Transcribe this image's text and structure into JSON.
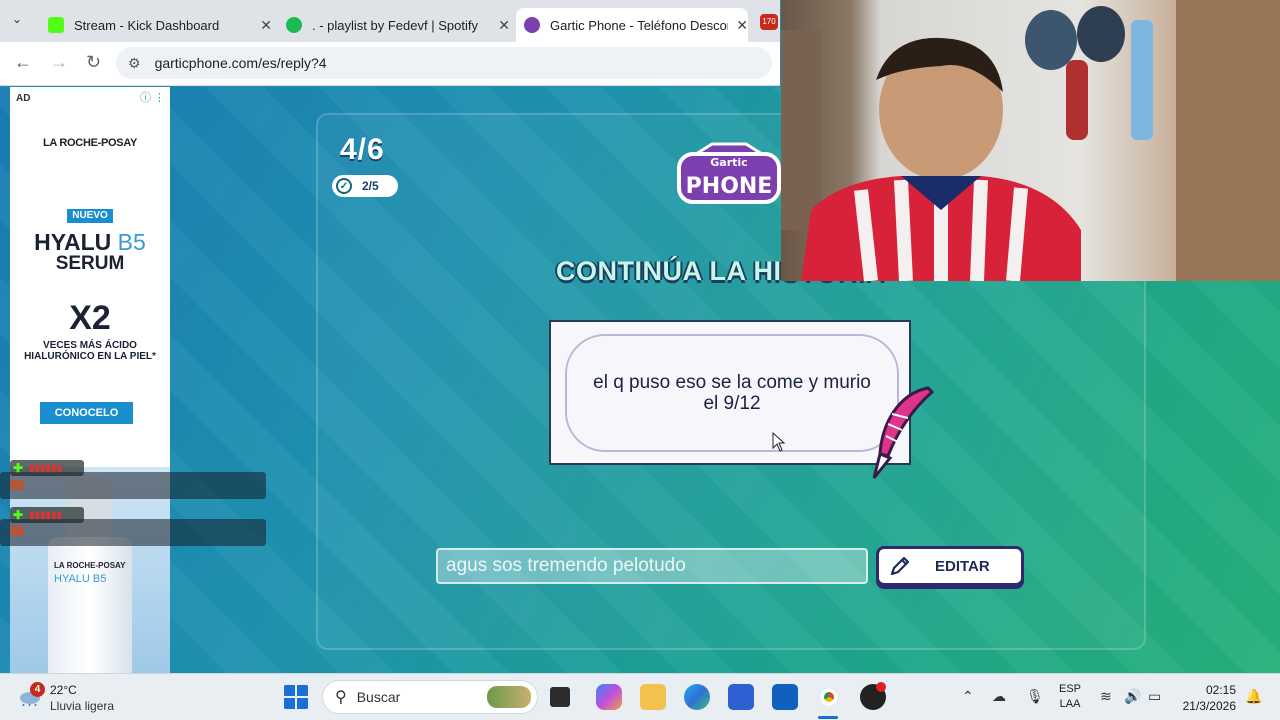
{
  "browser": {
    "tabs": [
      {
        "title": "Stream - Kick Dashboard",
        "close": "✕"
      },
      {
        "title": ". - playlist by Fedevf | Spotify",
        "close": "✕"
      },
      {
        "title": "Gartic Phone - Teléfono Descon",
        "close": "✕"
      }
    ],
    "extra_tab_badge": "170",
    "url": "garticphone.com/es/reply?4"
  },
  "game": {
    "round": "4/6",
    "submitted": "2/5",
    "logo_line1": "Gartic",
    "logo_line2": "PHONE",
    "heading": "CONTINÚA LA HISTORIA",
    "prompt_text": "el q puso eso se la come y murio el 9/12",
    "answer_value": "agus sos tremendo pelotudo",
    "edit_label": "EDITAR"
  },
  "ad": {
    "tag": "AD",
    "brand": "LA ROCHE-POSAY",
    "new": "NUEVO",
    "product_a": "HYALU",
    "product_b": "B5",
    "product_c": "SERUM",
    "x2": "X2",
    "desc": "VECES MÁS ÁCIDO HIALURÓNICO EN LA PIEL*",
    "cta": "CONOCELO",
    "bottle_brand": "LA ROCHE-POSAY",
    "bottle_name": "HYALU B5"
  },
  "taskbar": {
    "weather_temp": "22°C",
    "weather_desc": "Lluvia ligera",
    "weather_badge": "4",
    "search_placeholder": "Buscar",
    "lang_top": "ESP",
    "lang_bottom": "LAA",
    "time": "02:15",
    "date": "21/3/2026"
  },
  "colors": {
    "kick_green": "#53fc18",
    "spotify_green": "#1db954",
    "gartic_purple": "#7b3fb0",
    "cta_blue": "#1a8fd0"
  }
}
